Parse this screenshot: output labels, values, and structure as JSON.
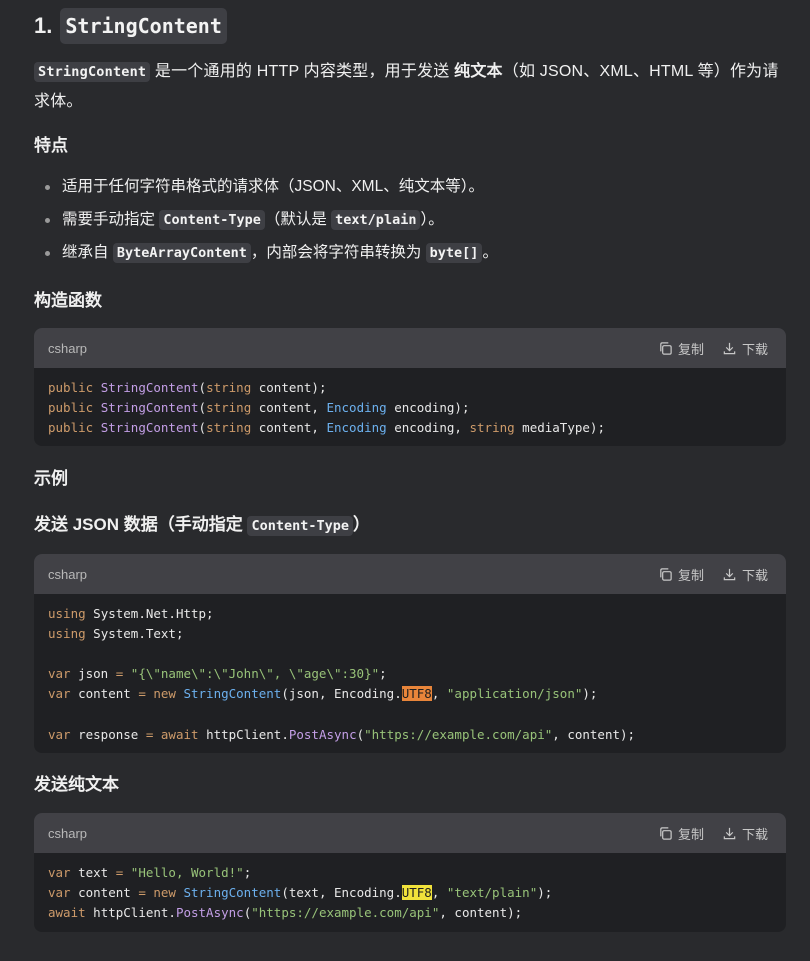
{
  "title": {
    "number": "1.",
    "code": "StringContent"
  },
  "intro": {
    "code": "StringContent",
    "text_a": " 是一个通用的 HTTP 内容类型，用于发送 ",
    "bold": "纯文本",
    "text_b": "（如 JSON、XML、HTML 等）作为请求体。"
  },
  "features": {
    "heading": "特点",
    "items": [
      {
        "text": "适用于任何字符串格式的请求体（JSON、XML、纯文本等）。"
      },
      {
        "pre": "需要手动指定 ",
        "code1": "Content-Type",
        "mid": "（默认是 ",
        "code2": "text/plain",
        "post": "）。"
      },
      {
        "pre": "继承自 ",
        "code1": "ByteArrayContent",
        "mid": "，内部会将字符串转换为 ",
        "code2": "byte[]",
        "post": "。"
      }
    ]
  },
  "constructors_heading": "构造函数",
  "examples_heading": "示例",
  "json_heading": {
    "text": "发送 JSON 数据（手动指定 ",
    "code": "Content-Type",
    "post": "）"
  },
  "plain_heading": "发送纯文本",
  "code_toolbar": {
    "copy_label": "复制",
    "download_label": "下载"
  },
  "code_blocks": [
    {
      "lang": "csharp",
      "lines": [
        [
          [
            "kw",
            "public "
          ],
          [
            "fn",
            "StringContent"
          ],
          [
            "",
            "("
          ],
          [
            "kw",
            "string"
          ],
          [
            "",
            " content);"
          ]
        ],
        [
          [
            "kw",
            "public "
          ],
          [
            "fn",
            "StringContent"
          ],
          [
            "",
            "("
          ],
          [
            "kw",
            "string"
          ],
          [
            "",
            " content, "
          ],
          [
            "cls",
            "Encoding"
          ],
          [
            "",
            " encoding);"
          ]
        ],
        [
          [
            "kw",
            "public "
          ],
          [
            "fn",
            "StringContent"
          ],
          [
            "",
            "("
          ],
          [
            "kw",
            "string"
          ],
          [
            "",
            " content, "
          ],
          [
            "cls",
            "Encoding"
          ],
          [
            "",
            " encoding, "
          ],
          [
            "kw",
            "string"
          ],
          [
            "",
            " mediaType);"
          ]
        ]
      ]
    },
    {
      "lang": "csharp",
      "lines": [
        [
          [
            "kw",
            "using"
          ],
          [
            "",
            " System.Net.Http;"
          ]
        ],
        [
          [
            "kw",
            "using"
          ],
          [
            "",
            " System.Text;"
          ]
        ],
        [],
        [
          [
            "kw",
            "var"
          ],
          [
            "",
            " json "
          ],
          [
            "kw",
            "="
          ],
          [
            "str",
            " \"{\\\"name\\\":\\\"John\\\", \\\"age\\\":30}\""
          ],
          [
            "",
            ";"
          ]
        ],
        [
          [
            "kw",
            "var"
          ],
          [
            "",
            " content "
          ],
          [
            "kw",
            "= new "
          ],
          [
            "cls",
            "StringContent"
          ],
          [
            "",
            "(json, Encoding."
          ],
          [
            "hl-o",
            "UTF8"
          ],
          [
            "",
            ", "
          ],
          [
            "str",
            "\"application/json\""
          ],
          [
            "",
            ");"
          ]
        ],
        [],
        [
          [
            "kw",
            "var"
          ],
          [
            "",
            " response "
          ],
          [
            "kw",
            "= await "
          ],
          [
            "",
            "httpClient."
          ],
          [
            "fn",
            "PostAsync"
          ],
          [
            "",
            "("
          ],
          [
            "str",
            "\"https://example.com/api\""
          ],
          [
            "",
            ", content);"
          ]
        ]
      ]
    },
    {
      "lang": "csharp",
      "lines": [
        [
          [
            "kw",
            "var"
          ],
          [
            "",
            " text "
          ],
          [
            "kw",
            "="
          ],
          [
            "str",
            " \"Hello, World!\""
          ],
          [
            "",
            ";"
          ]
        ],
        [
          [
            "kw",
            "var"
          ],
          [
            "",
            " content "
          ],
          [
            "kw",
            "= new "
          ],
          [
            "cls",
            "StringContent"
          ],
          [
            "",
            "(text, Encoding."
          ],
          [
            "hl-y",
            "UTF8"
          ],
          [
            "",
            ", "
          ],
          [
            "str",
            "\"text/plain\""
          ],
          [
            "",
            ");"
          ]
        ],
        [
          [
            "kw",
            "await"
          ],
          [
            "",
            " httpClient."
          ],
          [
            "fn",
            "PostAsync"
          ],
          [
            "",
            "("
          ],
          [
            "str",
            "\"https://example.com/api\""
          ],
          [
            "",
            ", content);"
          ]
        ]
      ]
    }
  ],
  "colors": {
    "background": "#292a2d",
    "code_background": "#1f2023",
    "code_header": "#414146",
    "keyword": "#ce9b6a",
    "function": "#c39ee6",
    "class": "#6cb0ee",
    "string": "#98c379",
    "highlight_orange": "#e8853a",
    "highlight_yellow": "#f1e23b"
  },
  "icons": {
    "copy": "copy-icon",
    "download": "download-icon"
  }
}
